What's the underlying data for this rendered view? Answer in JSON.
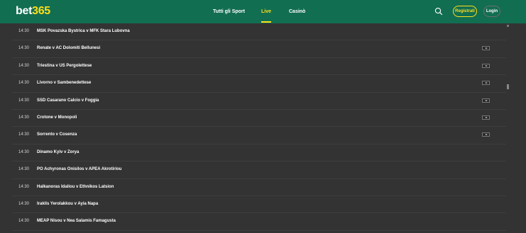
{
  "header": {
    "logo_left": "bet",
    "logo_right": "365",
    "nav": {
      "sport": "Tutti gli Sport",
      "live": "Live",
      "casino": "Casinò"
    },
    "register_label": "Registrati",
    "login_label": "Login",
    "brand_color": "#126e51",
    "accent_color": "#ffdf1b"
  },
  "matches": [
    {
      "time": "14:30",
      "name": "MSK Povazska Bystrica v MFK Stara Lubovna",
      "stream": false
    },
    {
      "time": "14:30",
      "name": "Renate v AC Dolomiti Bellunesi",
      "stream": true
    },
    {
      "time": "14:30",
      "name": "Triestina v US Pergolettese",
      "stream": true
    },
    {
      "time": "14:30",
      "name": "Livorno v Sambenedettese",
      "stream": true
    },
    {
      "time": "14:30",
      "name": "SSD Casarano Calcio v Foggia",
      "stream": true
    },
    {
      "time": "14:30",
      "name": "Crotone v Monopoli",
      "stream": true
    },
    {
      "time": "14:30",
      "name": "Sorrento v Cosenza",
      "stream": true
    },
    {
      "time": "14:30",
      "name": "Dinamo Kyiv v Zorya",
      "stream": false
    },
    {
      "time": "14:30",
      "name": "PO Achyronas Onisilos v APEA Akrotiriou",
      "stream": false
    },
    {
      "time": "14:30",
      "name": "Halkanoras Idaliou v Ethnikos Latsion",
      "stream": false
    },
    {
      "time": "14:30",
      "name": "Iraklis Yerolakkou v Ayia Napa",
      "stream": false
    },
    {
      "time": "14:30",
      "name": "MEAP Nisou v Nea Salamis Famagusta",
      "stream": false
    }
  ]
}
